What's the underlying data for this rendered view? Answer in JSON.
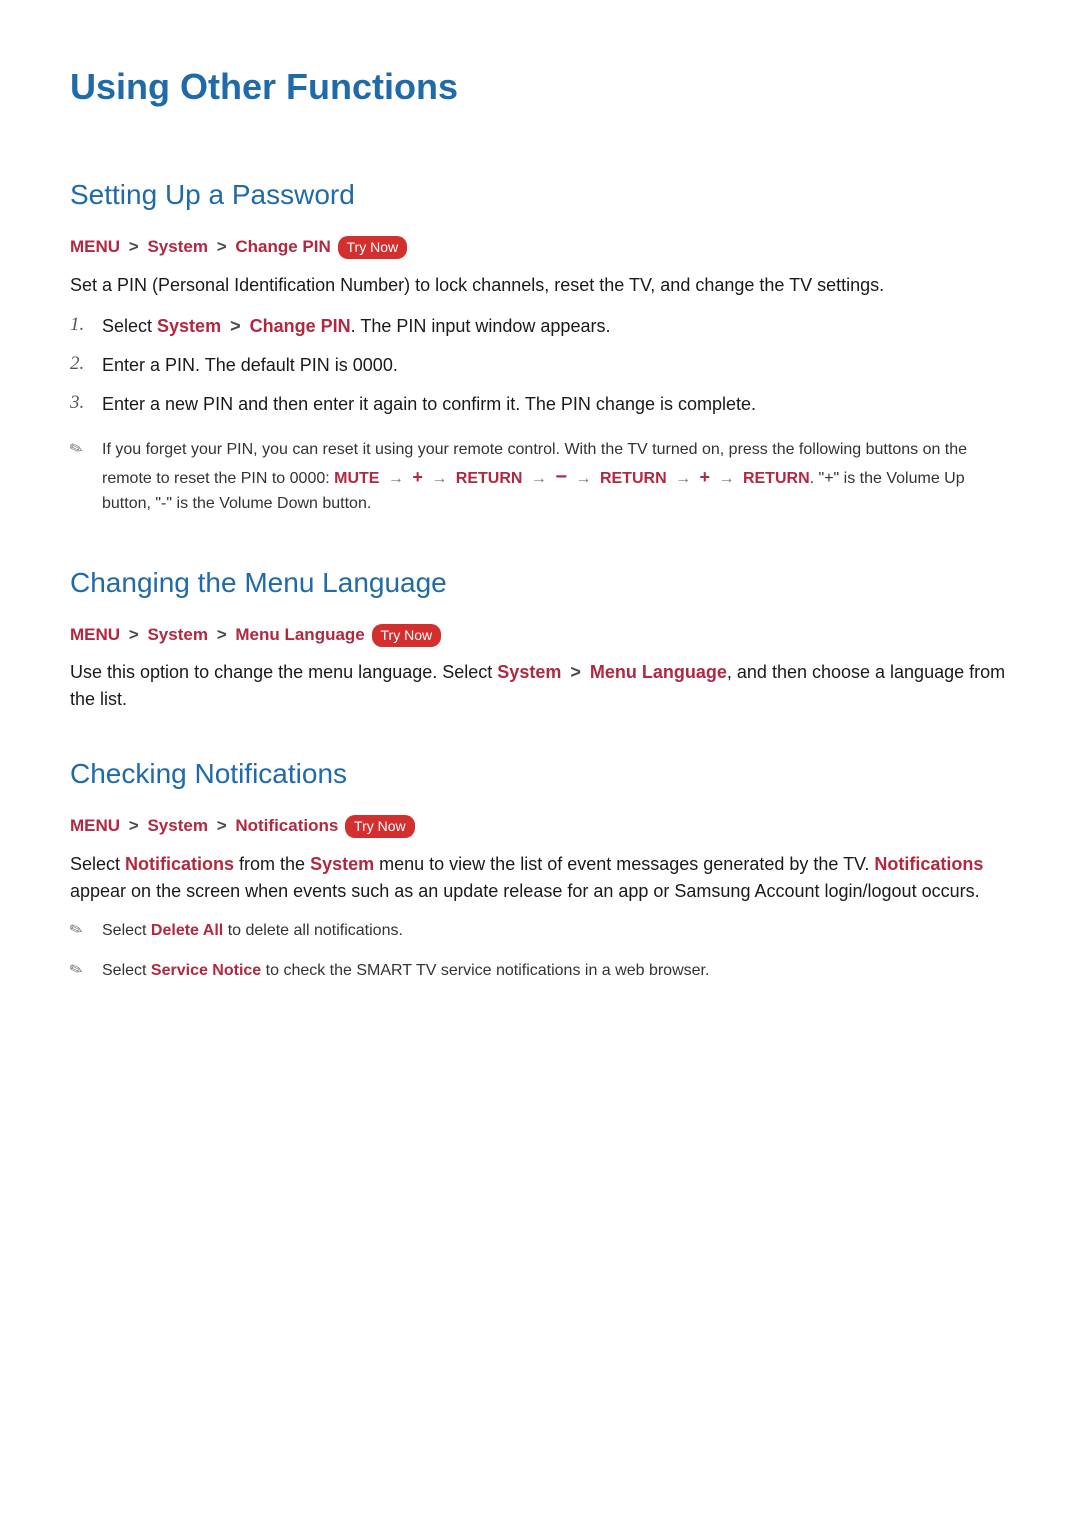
{
  "title": "Using Other Functions",
  "sections": {
    "s1": {
      "heading": "Setting Up a Password",
      "path": {
        "p0": "MENU",
        "p1": "System",
        "p2": "Change PIN"
      },
      "tryNow": "Try Now",
      "intro": "Set a PIN (Personal Identification Number) to lock channels, reset the TV, and change the TV settings.",
      "steps": {
        "n1": "1.",
        "t1a": "Select ",
        "t1b": "System",
        "t1c": "Change PIN",
        "t1d": ". The PIN input window appears.",
        "n2": "2.",
        "t2": "Enter a PIN. The default PIN is 0000.",
        "n3": "3.",
        "t3": "Enter a new PIN and then enter it again to confirm it. The PIN change is complete."
      },
      "note": {
        "a": "If you forget your PIN, you can reset it using your remote control. With the TV turned on, press the following buttons on the remote to reset the PIN to 0000: ",
        "mute": "MUTE",
        "ret": "RETURN",
        "tail": ". \"+\" is the Volume Up button, \"-\" is the Volume Down button."
      }
    },
    "s2": {
      "heading": "Changing the Menu Language",
      "path": {
        "p0": "MENU",
        "p1": "System",
        "p2": "Menu Language"
      },
      "tryNow": "Try Now",
      "body": {
        "a": "Use this option to change the menu language. Select ",
        "b": "System",
        "c": "Menu Language",
        "d": ", and then choose a language from the list."
      }
    },
    "s3": {
      "heading": "Checking Notifications",
      "path": {
        "p0": "MENU",
        "p1": "System",
        "p2": "Notifications"
      },
      "tryNow": "Try Now",
      "body": {
        "a": "Select ",
        "b": "Notifications",
        "c": " from the ",
        "d": "System",
        "e": " menu to view the list of event messages generated by the TV. ",
        "f": "Notifications",
        "g": " appear on the screen when events such as an update release for an app or Samsung Account login/logout occurs."
      },
      "note1": {
        "a": "Select ",
        "b": "Delete All",
        "c": " to delete all notifications."
      },
      "note2": {
        "a": "Select ",
        "b": "Service Notice",
        "c": " to check the SMART TV service notifications in a web browser."
      }
    }
  }
}
